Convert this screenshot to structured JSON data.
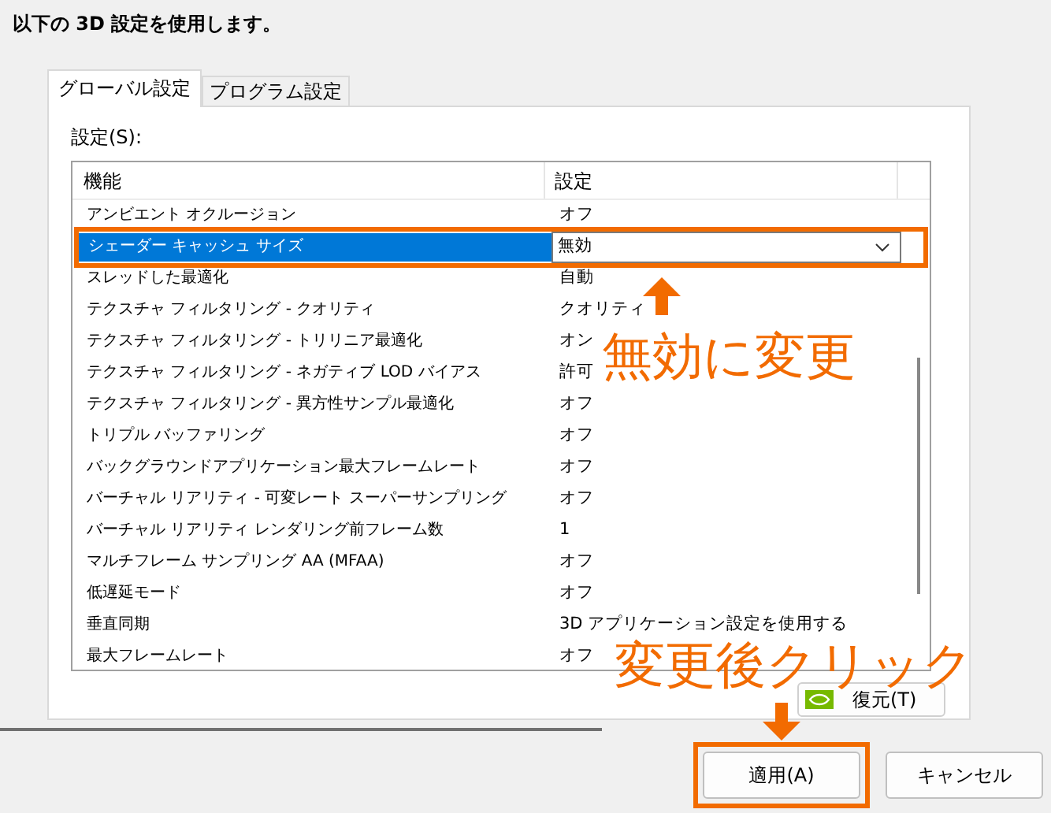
{
  "heading": "以下の 3D 設定を使用します。",
  "tabs": [
    {
      "label": "グローバル設定",
      "selected": true
    },
    {
      "label": "プログラム設定",
      "selected": false
    }
  ],
  "settings_label": "設定(S):",
  "table": {
    "columns": [
      "機能",
      "設定"
    ],
    "rows": [
      {
        "feature": "アンビエント オクルージョン",
        "value": "オフ",
        "selected": false,
        "kind": "text"
      },
      {
        "feature": "シェーダー キャッシュ サイズ",
        "value": "無効",
        "selected": true,
        "kind": "dropdown"
      },
      {
        "feature": "スレッドした最適化",
        "value": "自動",
        "selected": false,
        "kind": "text"
      },
      {
        "feature": "テクスチャ フィルタリング - クオリティ",
        "value": "クオリティ",
        "selected": false,
        "kind": "text"
      },
      {
        "feature": "テクスチャ フィルタリング - トリリニア最適化",
        "value": "オン",
        "selected": false,
        "kind": "text"
      },
      {
        "feature": "テクスチャ フィルタリング - ネガティブ LOD バイアス",
        "value": "許可",
        "selected": false,
        "kind": "text"
      },
      {
        "feature": "テクスチャ フィルタリング - 異方性サンプル最適化",
        "value": "オフ",
        "selected": false,
        "kind": "text"
      },
      {
        "feature": "トリプル バッファリング",
        "value": "オフ",
        "selected": false,
        "kind": "text"
      },
      {
        "feature": "バックグラウンドアプリケーション最大フレームレート",
        "value": "オフ",
        "selected": false,
        "kind": "text"
      },
      {
        "feature": "バーチャル リアリティ - 可変レート スーパーサンプリング",
        "value": "オフ",
        "selected": false,
        "kind": "text"
      },
      {
        "feature": "バーチャル リアリティ レンダリング前フレーム数",
        "value": "1",
        "selected": false,
        "kind": "text"
      },
      {
        "feature": "マルチフレーム サンプリング AA (MFAA)",
        "value": "オフ",
        "selected": false,
        "kind": "text"
      },
      {
        "feature": "低遅延モード",
        "value": "オフ",
        "selected": false,
        "kind": "text"
      },
      {
        "feature": "垂直同期",
        "value": "3D アプリケーション設定を使用する",
        "selected": false,
        "kind": "text"
      },
      {
        "feature": "最大フレームレート",
        "value": "オフ",
        "selected": false,
        "kind": "text"
      }
    ]
  },
  "restore_button": "復元(T)",
  "annotations": [
    {
      "text": "無効に変更"
    },
    {
      "text": "変更後クリック"
    }
  ],
  "buttons": [
    {
      "label": "適用(A)",
      "highlighted": true
    },
    {
      "label": "キャンセル",
      "highlighted": false
    }
  ]
}
